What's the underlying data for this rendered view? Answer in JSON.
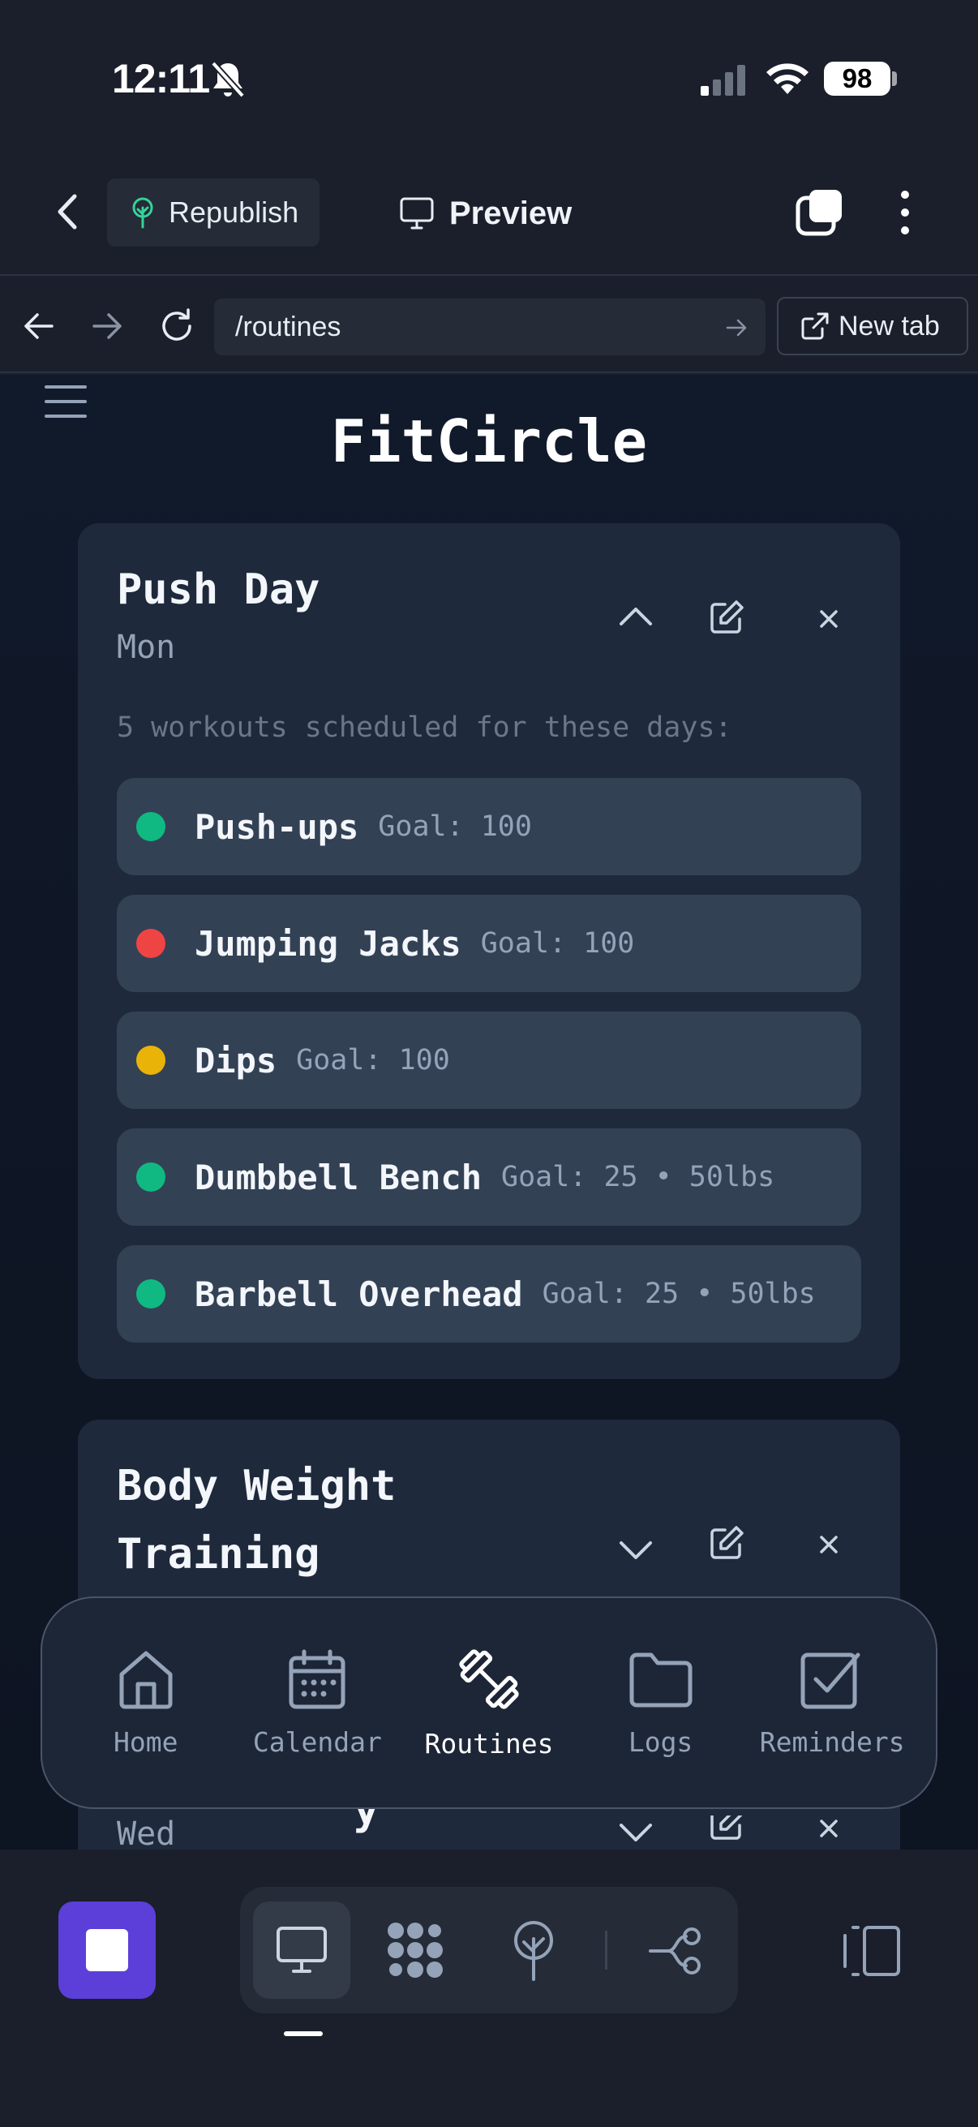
{
  "status_bar": {
    "time": "12:11",
    "battery": "98"
  },
  "topbar": {
    "republish_label": "Republish",
    "preview_label": "Preview"
  },
  "browser": {
    "url": "/routines",
    "new_tab_label": "New tab"
  },
  "app": {
    "title": "FitCircle",
    "routines": [
      {
        "title": "Push Day",
        "days": "Mon",
        "summary": "5 workouts scheduled for these days:",
        "expanded": true,
        "workouts": [
          {
            "name": "Push-ups",
            "goal": "Goal: 100",
            "status_color": "#10b981"
          },
          {
            "name": "Jumping Jacks",
            "goal": "Goal: 100",
            "status_color": "#ef4444"
          },
          {
            "name": "Dips",
            "goal": "Goal: 100",
            "status_color": "#eab308"
          },
          {
            "name": "Dumbbell Bench",
            "goal": "Goal: 25 • 50lbs",
            "status_color": "#10b981"
          },
          {
            "name": "Barbell Overhead",
            "goal": "Goal: 25 • 50lbs",
            "status_color": "#10b981"
          }
        ]
      },
      {
        "title_line1": "Body Weight",
        "title_line2": "Training",
        "expanded": false
      },
      {
        "title_partial": "y",
        "days_partial": "Wed",
        "expanded": false
      }
    ]
  },
  "tabbar": {
    "items": [
      {
        "label": "Home",
        "icon": "home-icon",
        "active": false
      },
      {
        "label": "Calendar",
        "icon": "calendar-icon",
        "active": false
      },
      {
        "label": "Routines",
        "icon": "dumbbell-icon",
        "active": true
      },
      {
        "label": "Logs",
        "icon": "folder-icon",
        "active": false
      },
      {
        "label": "Reminders",
        "icon": "checkbox-icon",
        "active": false
      }
    ]
  },
  "colors": {
    "accent": "#5b3fd8",
    "card": "#1e293b",
    "row": "#334155"
  }
}
